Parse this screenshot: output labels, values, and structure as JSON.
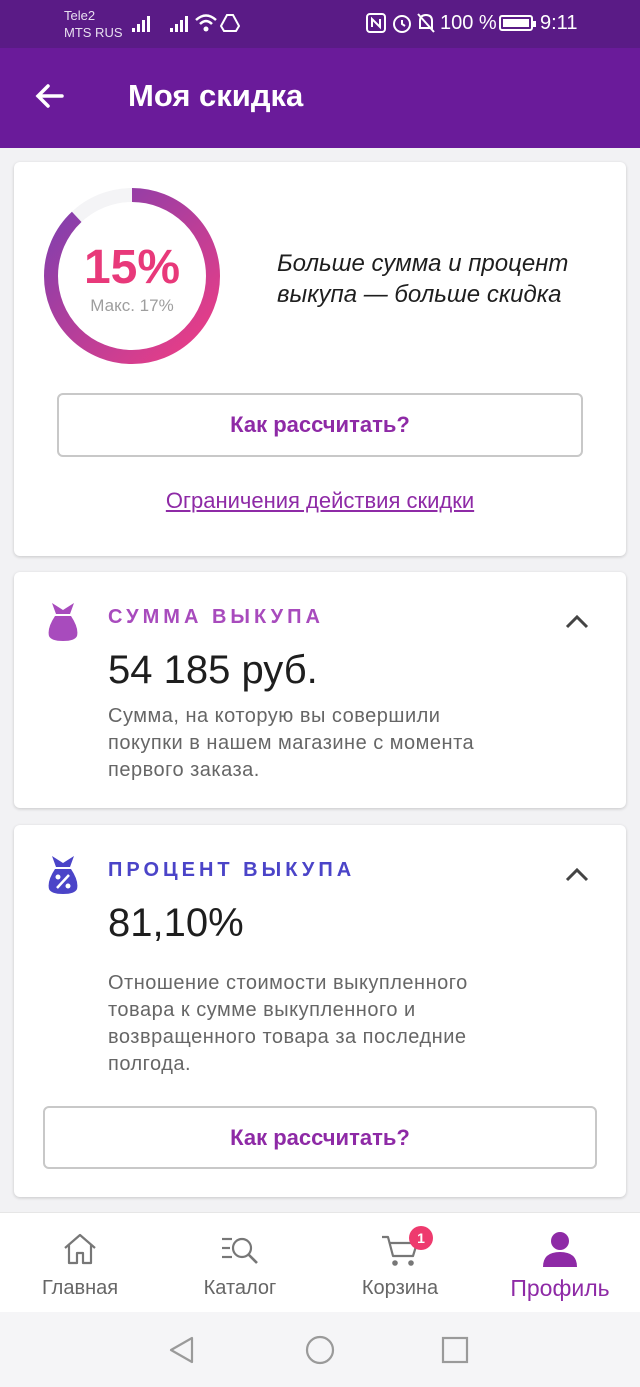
{
  "status_bar": {
    "carrier1": "Tele2",
    "carrier2": "MTS RUS",
    "battery": "100 %",
    "time": "9:11"
  },
  "app_bar": {
    "title": "Моя скидка",
    "back_icon": "arrow-left-icon"
  },
  "discount": {
    "percent": "15%",
    "max_label": "Макс. 17%",
    "progress_fraction": 0.88,
    "slogan_line1": "Больше сумма и процент",
    "slogan_line2": "выкупа — больше скидка",
    "how_button": "Как рассчитать?",
    "limits_link": "Ограничения действия скидки"
  },
  "purchase_sum": {
    "title": "СУММА ВЫКУПА",
    "value": "54 185 руб.",
    "desc_line1": "Сумма, на которую вы совершили",
    "desc_line2": "покупки в нашем магазине с момента",
    "desc_line3": "первого заказа.",
    "icon": "money-bag-icon",
    "color": "#a84bbd"
  },
  "purchase_percent": {
    "title": "ПРОЦЕНТ ВЫКУПА",
    "value": "81,10%",
    "desc_line1": "Отношение стоимости выкупленного",
    "desc_line2": "товара к сумме выкупленного и",
    "desc_line3": "возвращенного товара за последние",
    "desc_line4": "полгода.",
    "how_button": "Как рассчитать?",
    "icon": "percent-bag-icon",
    "color": "#4b44c8"
  },
  "bottom_nav": {
    "home": "Главная",
    "catalog": "Каталог",
    "cart": "Корзина",
    "cart_badge": "1",
    "profile": "Профиль"
  },
  "colors": {
    "primary": "#6a1b9a",
    "accent": "#8e2aa6",
    "ring_pink": "#e8397a"
  }
}
